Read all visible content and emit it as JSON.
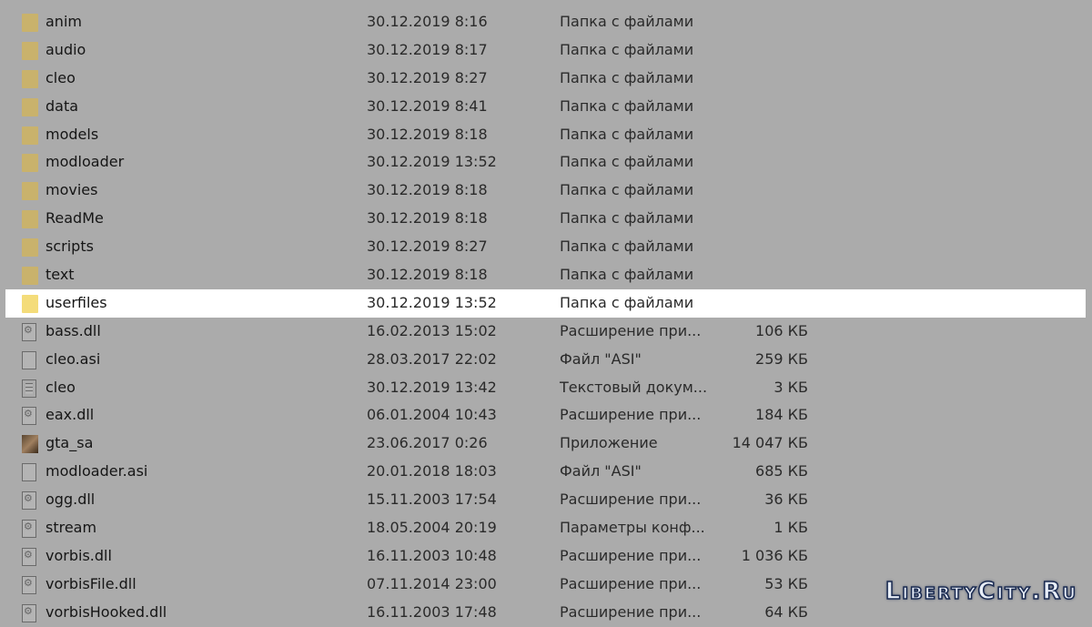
{
  "files": [
    {
      "name": "anim",
      "date": "30.12.2019 8:16",
      "type": "Папка с файлами",
      "size": "",
      "icon": "folder-icon"
    },
    {
      "name": "audio",
      "date": "30.12.2019 8:17",
      "type": "Папка с файлами",
      "size": "",
      "icon": "folder-icon"
    },
    {
      "name": "cleo",
      "date": "30.12.2019 8:27",
      "type": "Папка с файлами",
      "size": "",
      "icon": "folder-icon"
    },
    {
      "name": "data",
      "date": "30.12.2019 8:41",
      "type": "Папка с файлами",
      "size": "",
      "icon": "folder-icon"
    },
    {
      "name": "models",
      "date": "30.12.2019 8:18",
      "type": "Папка с файлами",
      "size": "",
      "icon": "folder-icon"
    },
    {
      "name": "modloader",
      "date": "30.12.2019 13:52",
      "type": "Папка с файлами",
      "size": "",
      "icon": "folder-icon"
    },
    {
      "name": "movies",
      "date": "30.12.2019 8:18",
      "type": "Папка с файлами",
      "size": "",
      "icon": "folder-icon"
    },
    {
      "name": "ReadMe",
      "date": "30.12.2019 8:18",
      "type": "Папка с файлами",
      "size": "",
      "icon": "folder-icon"
    },
    {
      "name": "scripts",
      "date": "30.12.2019 8:27",
      "type": "Папка с файлами",
      "size": "",
      "icon": "folder-icon"
    },
    {
      "name": "text",
      "date": "30.12.2019 8:18",
      "type": "Папка с файлами",
      "size": "",
      "icon": "folder-icon"
    },
    {
      "name": "userfiles",
      "date": "30.12.2019 13:52",
      "type": "Папка с файлами",
      "size": "",
      "icon": "folder-icon",
      "selected": true
    },
    {
      "name": "bass.dll",
      "date": "16.02.2013 15:02",
      "type": "Расширение при...",
      "size": "106 КБ",
      "icon": "dll-icon"
    },
    {
      "name": "cleo.asi",
      "date": "28.03.2017 22:02",
      "type": "Файл \"ASI\"",
      "size": "259 КБ",
      "icon": "file-icon"
    },
    {
      "name": "cleo",
      "date": "30.12.2019 13:42",
      "type": "Текстовый докум...",
      "size": "3 КБ",
      "icon": "text-file-icon"
    },
    {
      "name": "eax.dll",
      "date": "06.01.2004 10:43",
      "type": "Расширение при...",
      "size": "184 КБ",
      "icon": "dll-icon"
    },
    {
      "name": "gta_sa",
      "date": "23.06.2017 0:26",
      "type": "Приложение",
      "size": "14 047 КБ",
      "icon": "app-icon"
    },
    {
      "name": "modloader.asi",
      "date": "20.01.2018 18:03",
      "type": "Файл \"ASI\"",
      "size": "685 КБ",
      "icon": "file-icon"
    },
    {
      "name": "ogg.dll",
      "date": "15.11.2003 17:54",
      "type": "Расширение при...",
      "size": "36 КБ",
      "icon": "dll-icon"
    },
    {
      "name": "stream",
      "date": "18.05.2004 20:19",
      "type": "Параметры конф...",
      "size": "1 КБ",
      "icon": "config-file-icon"
    },
    {
      "name": "vorbis.dll",
      "date": "16.11.2003 10:48",
      "type": "Расширение при...",
      "size": "1 036 КБ",
      "icon": "dll-icon"
    },
    {
      "name": "vorbisFile.dll",
      "date": "07.11.2014 23:00",
      "type": "Расширение при...",
      "size": "53 КБ",
      "icon": "dll-icon"
    },
    {
      "name": "vorbisHooked.dll",
      "date": "16.11.2003 17:48",
      "type": "Расширение при...",
      "size": "64 КБ",
      "icon": "dll-icon"
    }
  ],
  "watermark": "LibertyCity.Ru",
  "colors": {
    "overlay": "#ababab",
    "selected_row": "#ffffff",
    "folder": "#f4dc7a"
  }
}
